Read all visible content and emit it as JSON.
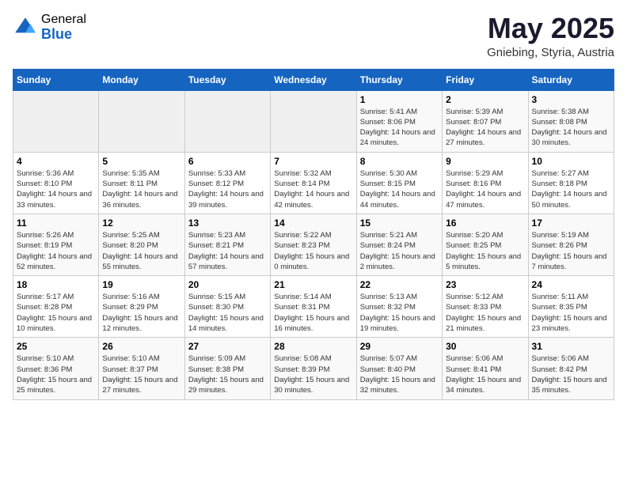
{
  "logo": {
    "general": "General",
    "blue": "Blue"
  },
  "title": "May 2025",
  "location": "Gniebing, Styria, Austria",
  "weekdays": [
    "Sunday",
    "Monday",
    "Tuesday",
    "Wednesday",
    "Thursday",
    "Friday",
    "Saturday"
  ],
  "weeks": [
    [
      {
        "day": "",
        "empty": true
      },
      {
        "day": "",
        "empty": true
      },
      {
        "day": "",
        "empty": true
      },
      {
        "day": "",
        "empty": true
      },
      {
        "day": "1",
        "sunrise": "5:41 AM",
        "sunset": "8:06 PM",
        "daylight": "14 hours and 24 minutes."
      },
      {
        "day": "2",
        "sunrise": "5:39 AM",
        "sunset": "8:07 PM",
        "daylight": "14 hours and 27 minutes."
      },
      {
        "day": "3",
        "sunrise": "5:38 AM",
        "sunset": "8:08 PM",
        "daylight": "14 hours and 30 minutes."
      }
    ],
    [
      {
        "day": "4",
        "sunrise": "5:36 AM",
        "sunset": "8:10 PM",
        "daylight": "14 hours and 33 minutes."
      },
      {
        "day": "5",
        "sunrise": "5:35 AM",
        "sunset": "8:11 PM",
        "daylight": "14 hours and 36 minutes."
      },
      {
        "day": "6",
        "sunrise": "5:33 AM",
        "sunset": "8:12 PM",
        "daylight": "14 hours and 39 minutes."
      },
      {
        "day": "7",
        "sunrise": "5:32 AM",
        "sunset": "8:14 PM",
        "daylight": "14 hours and 42 minutes."
      },
      {
        "day": "8",
        "sunrise": "5:30 AM",
        "sunset": "8:15 PM",
        "daylight": "14 hours and 44 minutes."
      },
      {
        "day": "9",
        "sunrise": "5:29 AM",
        "sunset": "8:16 PM",
        "daylight": "14 hours and 47 minutes."
      },
      {
        "day": "10",
        "sunrise": "5:27 AM",
        "sunset": "8:18 PM",
        "daylight": "14 hours and 50 minutes."
      }
    ],
    [
      {
        "day": "11",
        "sunrise": "5:26 AM",
        "sunset": "8:19 PM",
        "daylight": "14 hours and 52 minutes."
      },
      {
        "day": "12",
        "sunrise": "5:25 AM",
        "sunset": "8:20 PM",
        "daylight": "14 hours and 55 minutes."
      },
      {
        "day": "13",
        "sunrise": "5:23 AM",
        "sunset": "8:21 PM",
        "daylight": "14 hours and 57 minutes."
      },
      {
        "day": "14",
        "sunrise": "5:22 AM",
        "sunset": "8:23 PM",
        "daylight": "15 hours and 0 minutes."
      },
      {
        "day": "15",
        "sunrise": "5:21 AM",
        "sunset": "8:24 PM",
        "daylight": "15 hours and 2 minutes."
      },
      {
        "day": "16",
        "sunrise": "5:20 AM",
        "sunset": "8:25 PM",
        "daylight": "15 hours and 5 minutes."
      },
      {
        "day": "17",
        "sunrise": "5:19 AM",
        "sunset": "8:26 PM",
        "daylight": "15 hours and 7 minutes."
      }
    ],
    [
      {
        "day": "18",
        "sunrise": "5:17 AM",
        "sunset": "8:28 PM",
        "daylight": "15 hours and 10 minutes."
      },
      {
        "day": "19",
        "sunrise": "5:16 AM",
        "sunset": "8:29 PM",
        "daylight": "15 hours and 12 minutes."
      },
      {
        "day": "20",
        "sunrise": "5:15 AM",
        "sunset": "8:30 PM",
        "daylight": "15 hours and 14 minutes."
      },
      {
        "day": "21",
        "sunrise": "5:14 AM",
        "sunset": "8:31 PM",
        "daylight": "15 hours and 16 minutes."
      },
      {
        "day": "22",
        "sunrise": "5:13 AM",
        "sunset": "8:32 PM",
        "daylight": "15 hours and 19 minutes."
      },
      {
        "day": "23",
        "sunrise": "5:12 AM",
        "sunset": "8:33 PM",
        "daylight": "15 hours and 21 minutes."
      },
      {
        "day": "24",
        "sunrise": "5:11 AM",
        "sunset": "8:35 PM",
        "daylight": "15 hours and 23 minutes."
      }
    ],
    [
      {
        "day": "25",
        "sunrise": "5:10 AM",
        "sunset": "8:36 PM",
        "daylight": "15 hours and 25 minutes."
      },
      {
        "day": "26",
        "sunrise": "5:10 AM",
        "sunset": "8:37 PM",
        "daylight": "15 hours and 27 minutes."
      },
      {
        "day": "27",
        "sunrise": "5:09 AM",
        "sunset": "8:38 PM",
        "daylight": "15 hours and 29 minutes."
      },
      {
        "day": "28",
        "sunrise": "5:08 AM",
        "sunset": "8:39 PM",
        "daylight": "15 hours and 30 minutes."
      },
      {
        "day": "29",
        "sunrise": "5:07 AM",
        "sunset": "8:40 PM",
        "daylight": "15 hours and 32 minutes."
      },
      {
        "day": "30",
        "sunrise": "5:06 AM",
        "sunset": "8:41 PM",
        "daylight": "15 hours and 34 minutes."
      },
      {
        "day": "31",
        "sunrise": "5:06 AM",
        "sunset": "8:42 PM",
        "daylight": "15 hours and 35 minutes."
      }
    ]
  ]
}
